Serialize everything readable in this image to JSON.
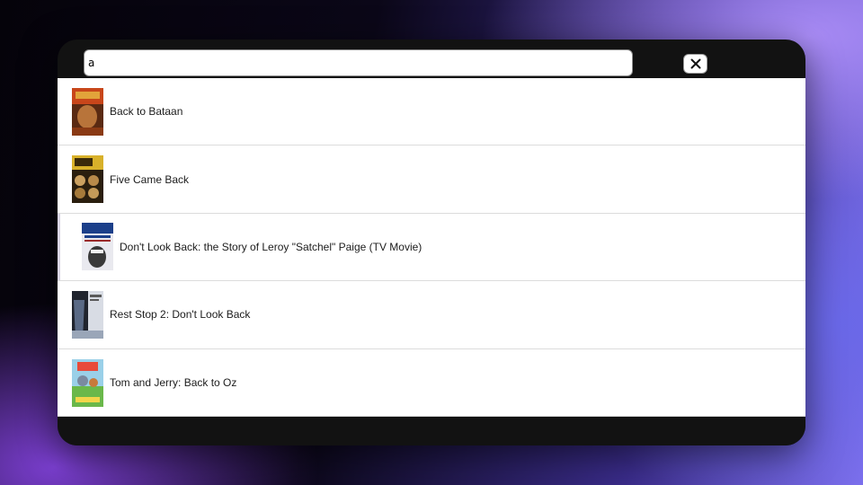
{
  "search": {
    "value": "a",
    "placeholder": ""
  },
  "close_button": {
    "icon": "close-icon"
  },
  "results": [
    {
      "title": "Back to Bataan",
      "poster_colors": [
        "#c8461a",
        "#e2a33a",
        "#5a2a12"
      ]
    },
    {
      "title": "Five Came Back",
      "poster_colors": [
        "#d8b12a",
        "#7a5a1e",
        "#2a1e0e"
      ]
    },
    {
      "title": "Don't Look Back: the Story of Leroy \"Satchel\" Paige (TV Movie)",
      "poster_colors": [
        "#1b3f8a",
        "#e9e9ef",
        "#3a3a3a"
      ],
      "active": true
    },
    {
      "title": "Rest Stop 2: Don't Look Back",
      "poster_colors": [
        "#20242e",
        "#9aa6b8",
        "#5a6a86"
      ]
    },
    {
      "title": "Tom and Jerry: Back to Oz",
      "poster_colors": [
        "#6ab84a",
        "#e84a3a",
        "#f2d64a"
      ]
    }
  ]
}
